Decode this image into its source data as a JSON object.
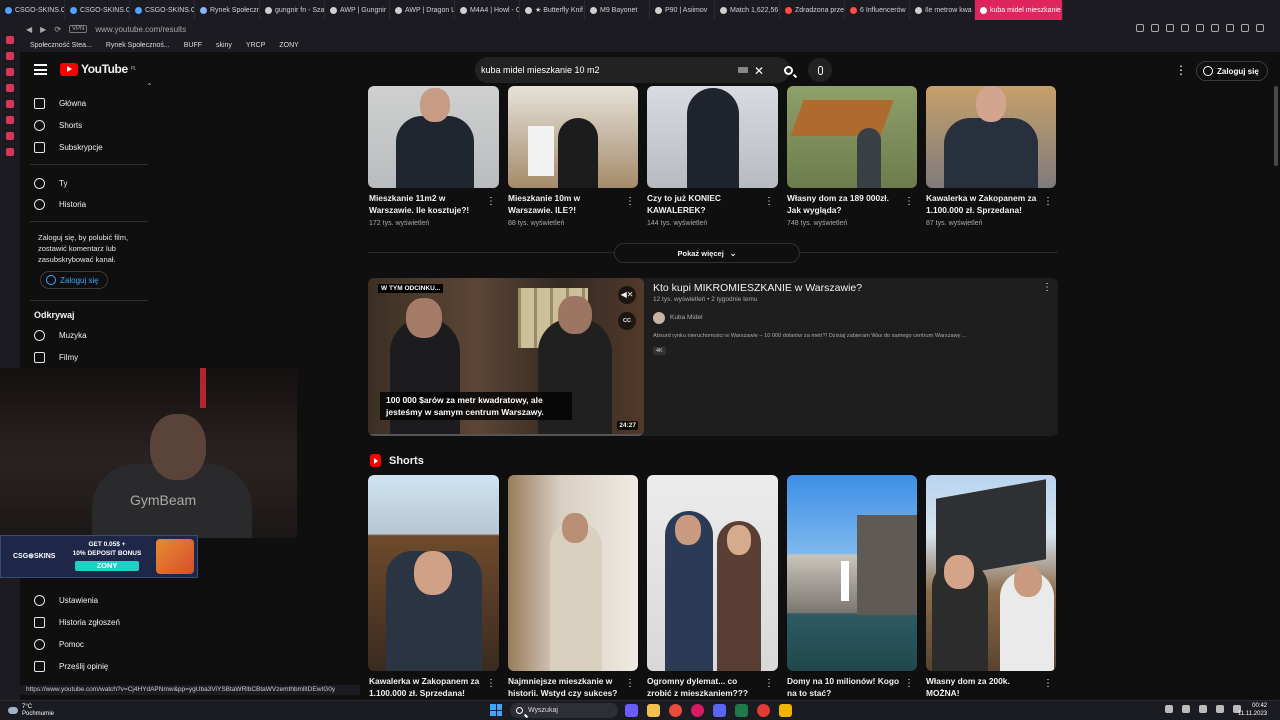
{
  "browser": {
    "tabs": [
      {
        "label": "CSGO-SKINS.CO",
        "color": "#4fa3ff"
      },
      {
        "label": "CSGO-SKINS.CO",
        "color": "#4fa3ff"
      },
      {
        "label": "CSGO-SKINS.CO",
        "color": "#4fa3ff"
      },
      {
        "label": "Rynek Społeczn",
        "color": "#8ab4f8"
      },
      {
        "label": "gungnir fn - Sza",
        "color": "#cfcfcf"
      },
      {
        "label": "AWP | Gungnir",
        "color": "#cfcfcf"
      },
      {
        "label": "AWP | Dragon L",
        "color": "#cfcfcf"
      },
      {
        "label": "M4A4 | Howl - C",
        "color": "#cfcfcf"
      },
      {
        "label": "★ Butterfly Knif",
        "color": "#cfcfcf"
      },
      {
        "label": "M9 Bayonet",
        "color": "#cfcfcf"
      },
      {
        "label": "P90 | Asiimov",
        "color": "#cfcfcf"
      },
      {
        "label": "Match 1,622,56",
        "color": "#cfcfcf"
      },
      {
        "label": "Zdradzona prze",
        "color": "#ff4e45"
      },
      {
        "label": "6 Influencerów",
        "color": "#ff4e45"
      },
      {
        "label": "Ile metrow kwa",
        "color": "#cfcfcf"
      },
      {
        "label": "kuba midel mieszkanie 10",
        "color": "#ff4e45",
        "active": true
      }
    ],
    "url": "www.youtube.com/results",
    "bookmarks": [
      "Społeczność Stea...",
      "Rynek Społecznoś...",
      "BUFF",
      "skiny",
      "YRCP",
      "ZONY"
    ],
    "status_url": "https://www.youtube.com/watch?v=Cj4HYdAPNmw&pp=ygUba3ViYSBtaWRlbCBtaWVzemthbmllIDEwIG0y"
  },
  "header": {
    "logo_text": "YouTube",
    "logo_region": "PL",
    "search_value": "kuba midel mieszkanie 10 m2",
    "signin_label": "Zaloguj się",
    "search_icon": "search-icon",
    "mic_icon": "mic-icon",
    "accent": "#ff0000"
  },
  "sidebar": {
    "items_top": [
      {
        "label": "Główna",
        "icon": "home-icon"
      },
      {
        "label": "Shorts",
        "icon": "shorts-icon"
      },
      {
        "label": "Subskrypcje",
        "icon": "subscriptions-icon"
      }
    ],
    "items_you": [
      {
        "label": "Ty",
        "icon": "you-icon"
      },
      {
        "label": "Historia",
        "icon": "history-icon"
      }
    ],
    "signin_note": "Zaloguj się, by polubić film, zostawić komentarz lub zasubskrybować kanał.",
    "signin_label": "Zaloguj się",
    "discover_title": "Odkrywaj",
    "items_discover": [
      {
        "label": "Muzyka",
        "icon": "music-icon"
      },
      {
        "label": "Filmy",
        "icon": "film-icon"
      }
    ],
    "items_bottom": [
      {
        "label": "Ustawienia",
        "icon": "gear-icon"
      },
      {
        "label": "Historia zgłoszeń",
        "icon": "flag-icon"
      },
      {
        "label": "Pomoc",
        "icon": "help-icon"
      },
      {
        "label": "Prześlij opinię",
        "icon": "feedback-icon"
      }
    ]
  },
  "overlay": {
    "shirt_text": "GymBeam",
    "promo_brand": "CSG⊕SKINS",
    "promo_line1": "GET 0.05$ +",
    "promo_line2": "10% DEPOSIT BONUS",
    "promo_code": "ZONY"
  },
  "videos_row": [
    {
      "title": "Mieszkanie 11m2 w Warszawie. Ile kosztuje?!",
      "meta": "172 tys. wyświetleń"
    },
    {
      "title": "Mieszkanie 10m w Warszawie. ILE?!",
      "meta": "88 tys. wyświetleń"
    },
    {
      "title": "Czy to już KONIEC KAWALEREK?",
      "meta": "144 tys. wyświetleń"
    },
    {
      "title": "Własny dom za 189 000zł. Jak wygląda?",
      "meta": "748 tys. wyświetleń"
    },
    {
      "title": "Kawalerka w Zakopanem za 1.100.000 zł. Sprzedana!",
      "meta": "87 tys. wyświetleń"
    }
  ],
  "more_button": "Pokaż więcej",
  "featured": {
    "title": "Kto kupi MIKROMIESZKANIE w Warszawie?",
    "meta": "12 tys. wyświetleń • 2 tygodnie temu",
    "channel": "Kuba Midel",
    "description": "Absurd rynku nieruchomości w Warszawie – 10 000 dolarów za metr?! Dzisiaj zabieram Was do samego centrum Warszawy ...",
    "badge": "4K",
    "chapter_label": "W TYM ODCINKU...",
    "subtitle": "100 000 $arów za metr kwadratowy, ale jesteśmy w samym centrum Warszawy.",
    "duration": "24:27",
    "cc_label": "CC"
  },
  "shorts": {
    "heading": "Shorts",
    "items": [
      {
        "title": "Kawalerka w Zakopanem za 1.100.000 zł. Sprzedana!"
      },
      {
        "title": "Najmniejsze mieszkanie w historii. Wstyd czy sukces?"
      },
      {
        "title": "Ogromny dylemat... co zrobić z mieszkaniem???"
      },
      {
        "title": "Domy na 10 milionów! Kogo na to stać?"
      },
      {
        "title": "Własny dom za 200k. MOŻNA!"
      }
    ]
  },
  "taskbar": {
    "temp": "7°C",
    "weather": "Pochmurnie",
    "search_label": "Wyszukaj",
    "time": "00:42",
    "date": "11.11.2023"
  }
}
